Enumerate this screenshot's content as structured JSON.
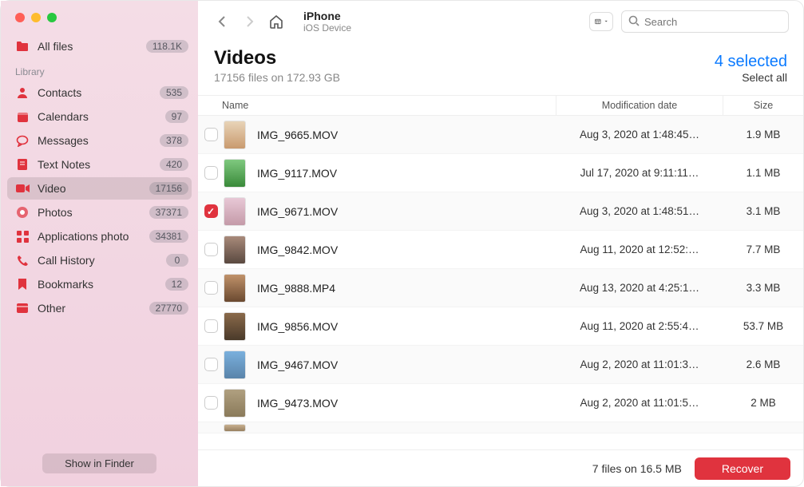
{
  "titlebar": {
    "device": "iPhone",
    "subtitle": "iOS Device"
  },
  "search": {
    "placeholder": "Search"
  },
  "sidebar": {
    "allfiles": {
      "label": "All files",
      "badge": "118.1K"
    },
    "library_label": "Library",
    "items": [
      {
        "label": "Contacts",
        "badge": "535"
      },
      {
        "label": "Calendars",
        "badge": "97"
      },
      {
        "label": "Messages",
        "badge": "378"
      },
      {
        "label": "Text Notes",
        "badge": "420"
      },
      {
        "label": "Video",
        "badge": "17156"
      },
      {
        "label": "Photos",
        "badge": "37371"
      },
      {
        "label": "Applications photo",
        "badge": "34381"
      },
      {
        "label": "Call History",
        "badge": "0"
      },
      {
        "label": "Bookmarks",
        "badge": "12"
      },
      {
        "label": "Other",
        "badge": "27770"
      }
    ],
    "footer_btn": "Show in Finder"
  },
  "heading": {
    "title": "Videos",
    "subtitle": "17156 files on 172.93 GB",
    "selected": "4 selected",
    "selectall": "Select all"
  },
  "columns": {
    "name": "Name",
    "date": "Modification date",
    "size": "Size"
  },
  "files": [
    {
      "name": "IMG_9665.MOV",
      "date": "Aug 3, 2020 at 1:48:45…",
      "size": "1.9 MB",
      "checked": false
    },
    {
      "name": "IMG_9117.MOV",
      "date": "Jul 17, 2020 at 9:11:11…",
      "size": "1.1 MB",
      "checked": false
    },
    {
      "name": "IMG_9671.MOV",
      "date": "Aug 3, 2020 at 1:48:51…",
      "size": "3.1 MB",
      "checked": true
    },
    {
      "name": "IMG_9842.MOV",
      "date": "Aug 11, 2020 at 12:52:…",
      "size": "7.7 MB",
      "checked": false
    },
    {
      "name": "IMG_9888.MP4",
      "date": "Aug 13, 2020 at 4:25:1…",
      "size": "3.3 MB",
      "checked": false
    },
    {
      "name": "IMG_9856.MOV",
      "date": "Aug 11, 2020 at 2:55:4…",
      "size": "53.7 MB",
      "checked": false
    },
    {
      "name": "IMG_9467.MOV",
      "date": "Aug 2, 2020 at 11:01:3…",
      "size": "2.6 MB",
      "checked": false
    },
    {
      "name": "IMG_9473.MOV",
      "date": "Aug 2, 2020 at 11:01:5…",
      "size": "2 MB",
      "checked": false
    }
  ],
  "bottombar": {
    "status": "7 files on 16.5 MB",
    "recover": "Recover"
  }
}
